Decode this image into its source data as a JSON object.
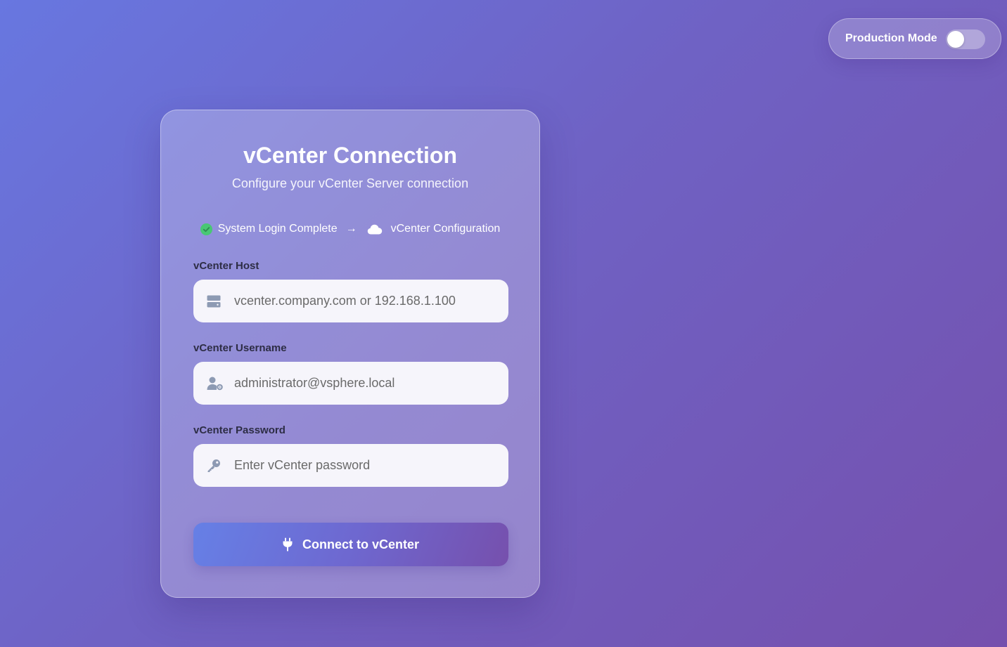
{
  "production_mode": {
    "label": "Production Mode",
    "enabled": false
  },
  "card": {
    "title": "vCenter Connection",
    "subtitle": "Configure your vCenter Server connection",
    "steps": {
      "completed": "System Login Complete",
      "separator": "→",
      "current": "vCenter Configuration"
    },
    "fields": {
      "host": {
        "label": "vCenter Host",
        "value": "",
        "placeholder": "vcenter.company.com or 192.168.1.100",
        "icon": "server-icon"
      },
      "username": {
        "label": "vCenter Username",
        "value": "",
        "placeholder": "administrator@vsphere.local",
        "icon": "user-gear-icon"
      },
      "password": {
        "label": "vCenter Password",
        "value": "",
        "placeholder": "Enter vCenter password",
        "icon": "key-icon"
      }
    },
    "connect_button": {
      "label": "Connect to vCenter",
      "icon": "plug-icon"
    }
  },
  "colors": {
    "success": "#48c774",
    "icon_gray": "#8d9ab3"
  }
}
